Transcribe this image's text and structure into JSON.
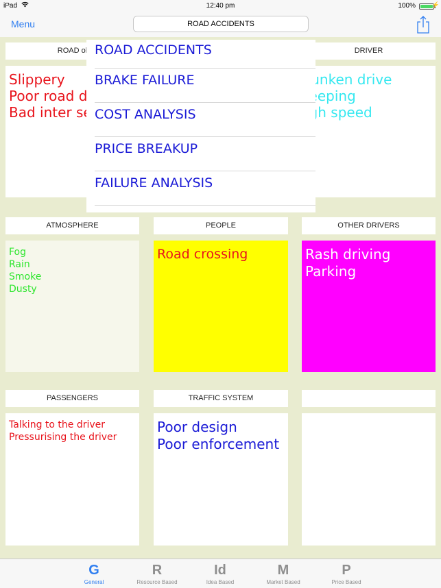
{
  "status_bar": {
    "device": "iPad",
    "time": "12:40 pm",
    "battery": "100%"
  },
  "nav": {
    "menu_label": "Menu",
    "title": "ROAD ACCIDENTS"
  },
  "dropdown": {
    "items": [
      "ROAD ACCIDENTS",
      "BRAKE FAILURE",
      "COST ANALYSIS",
      "PRICE BREAKUP",
      "FAILURE ANALYSIS"
    ]
  },
  "grid": {
    "cells": [
      {
        "header": "ROAD ol",
        "lines": [
          "Slippery",
          "Poor road d",
          "Bad inter se"
        ],
        "text_color": "#e8141c",
        "bg_color": "#ffffff"
      },
      {
        "header": "",
        "lines": [],
        "text_color": "#000000",
        "bg_color": "#ffffff"
      },
      {
        "header": "DRIVER",
        "lines": [
          "runken drive",
          "leeping",
          "igh speed"
        ],
        "text_color": "#35e8f0",
        "bg_color": "#ffffff"
      },
      {
        "header": "ATMOSPHERE",
        "lines": [
          "Fog",
          "Rain",
          "Smoke",
          "Dusty"
        ],
        "text_color": "#2ee62e",
        "bg_color": "#f6f7eb"
      },
      {
        "header": "PEOPLE",
        "lines": [
          "Road crossing"
        ],
        "text_color": "#e8141c",
        "bg_color": "#ffff00"
      },
      {
        "header": "OTHER DRIVERS",
        "lines": [
          "Rash driving",
          "Parking"
        ],
        "text_color": "#ffffff",
        "bg_color": "#ff00ff"
      },
      {
        "header": "PASSENGERS",
        "lines": [
          "Talking to the driver",
          "Pressurising the driver"
        ],
        "text_color": "#e8141c",
        "bg_color": "#ffffff"
      },
      {
        "header": "TRAFFIC SYSTEM",
        "lines": [
          "Poor design",
          "Poor enforcement"
        ],
        "text_color": "#1a1ad6",
        "bg_color": "#ffffff"
      },
      {
        "header": "",
        "lines": [],
        "text_color": "#000000",
        "bg_color": "#ffffff"
      }
    ]
  },
  "tabbar": {
    "tabs": [
      {
        "glyph": "G",
        "label": "General",
        "active": true
      },
      {
        "glyph": "R",
        "label": "Resource Based",
        "active": false
      },
      {
        "glyph": "Id",
        "label": "Idea Based",
        "active": false
      },
      {
        "glyph": "M",
        "label": "Market Based",
        "active": false
      },
      {
        "glyph": "P",
        "label": "Price Based",
        "active": false
      }
    ]
  },
  "colors": {
    "accent": "#2f7ef0",
    "background": "#e9ecd0",
    "dropdown_text": "#1a1ad6"
  }
}
